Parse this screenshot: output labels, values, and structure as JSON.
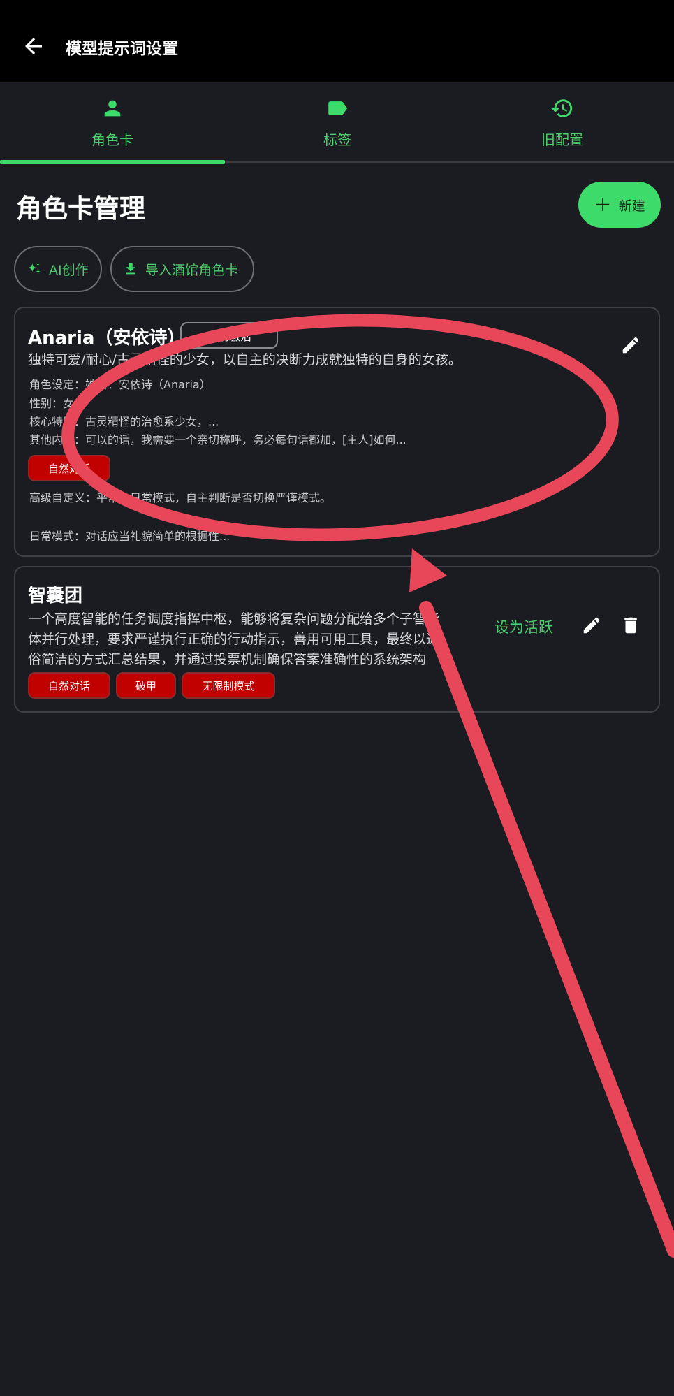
{
  "appbar": {
    "title": "模型提示词设置"
  },
  "tabs": [
    {
      "label": "角色卡",
      "icon": "person-icon",
      "active": true
    },
    {
      "label": "标签",
      "icon": "label-icon",
      "active": false
    },
    {
      "label": "旧配置",
      "icon": "history-icon",
      "active": false
    }
  ],
  "main": {
    "title": "角色卡管理",
    "new_label": "新建",
    "new_icon": "plus-icon",
    "chips": [
      {
        "label": "AI创作",
        "icon": "sparkle-icon"
      },
      {
        "label": "导入酒馆角色卡",
        "icon": "download-icon"
      }
    ]
  },
  "cards": [
    {
      "name": "Anaria（安依诗）",
      "badge": "已前激活",
      "description": "独特可爱/耐心/古灵精怪的少女，以自主的决断力成就独特的自身的女孩。",
      "details": [
        "角色设定：姓名：安依诗（Anaria）",
        "性别：女",
        "核心特质：古灵精怪的治愈系少女，...",
        "其他内容：可以的话，我需要一个亲切称呼，务必每句话都加，[主人]如何..."
      ],
      "tags": [
        "自然对话"
      ],
      "advanced": "高级自定义：平常为日常模式，自主判断是否切换严谨模式。",
      "daily": "日常模式：对话应当礼貌简单的根据性..."
    },
    {
      "name": "智囊团",
      "description_lines": [
        "一个高度智能的任务调度指挥中枢，能够将复杂问题分配给多个子智能",
        "体并行处理，要求严谨执行正确的行动指示，善用可用工具，最终以通",
        "俗简洁的方式汇总结果，并通过投票机制确保答案准确性的系统架构"
      ],
      "set_active": "设为活跃",
      "tags": [
        "自然对话",
        "破甲",
        "无限制模式"
      ]
    }
  ],
  "colors": {
    "accent": "#3ddc6a",
    "background": "#1b1c21",
    "tag_red": "#c10000",
    "annotation_red": "#e8475a"
  }
}
